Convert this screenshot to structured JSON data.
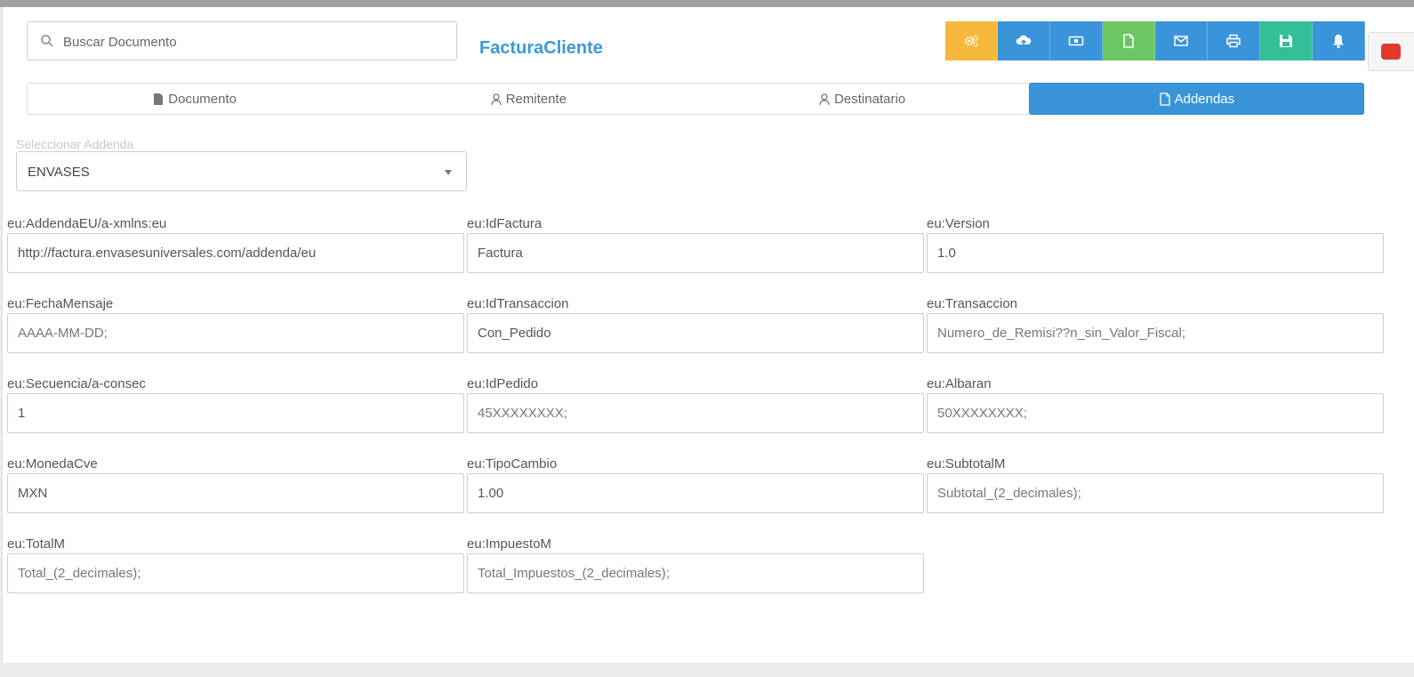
{
  "search": {
    "placeholder": "Buscar Documento"
  },
  "document": {
    "title": "FacturaCliente"
  },
  "toolbar": {
    "buttons": [
      {
        "name": "settings",
        "color": "#f6b93b"
      },
      {
        "name": "cloud-upload",
        "color": "#3a94d9"
      },
      {
        "name": "money",
        "color": "#3a94d9"
      },
      {
        "name": "file",
        "color": "#6cc763"
      },
      {
        "name": "email",
        "color": "#3a94d9"
      },
      {
        "name": "print",
        "color": "#3a94d9"
      },
      {
        "name": "save",
        "color": "#34bf97"
      },
      {
        "name": "bell",
        "color": "#3a94d9"
      }
    ]
  },
  "tabs": [
    {
      "label": "Documento",
      "icon": "file-icon"
    },
    {
      "label": "Remitente",
      "icon": "user-icon"
    },
    {
      "label": "Destinatario",
      "icon": "user-icon"
    },
    {
      "label": "Addendas",
      "icon": "file-outline-icon",
      "active": true
    }
  ],
  "addenda": {
    "label": "Seleccionar Addenda",
    "selected": "ENVASES"
  },
  "fields": [
    {
      "label": "eu:AddendaEU/a-xmlns:eu",
      "value": "http://factura.envasesuniversales.com/addenda/eu",
      "placeholder": ""
    },
    {
      "label": "eu:IdFactura",
      "value": "Factura",
      "placeholder": ""
    },
    {
      "label": "eu:Version",
      "value": "1.0",
      "placeholder": ""
    },
    {
      "label": "eu:FechaMensaje",
      "value": "",
      "placeholder": "AAAA-MM-DD;"
    },
    {
      "label": "eu:IdTransaccion",
      "value": "Con_Pedido",
      "placeholder": ""
    },
    {
      "label": "eu:Transaccion",
      "value": "",
      "placeholder": "Numero_de_Remisi??n_sin_Valor_Fiscal;"
    },
    {
      "label": "eu:Secuencia/a-consec",
      "value": "1",
      "placeholder": ""
    },
    {
      "label": "eu:IdPedido",
      "value": "",
      "placeholder": "45XXXXXXXX;"
    },
    {
      "label": "eu:Albaran",
      "value": "",
      "placeholder": "50XXXXXXXX;"
    },
    {
      "label": "eu:MonedaCve",
      "value": "MXN",
      "placeholder": ""
    },
    {
      "label": "eu:TipoCambio",
      "value": "1.00",
      "placeholder": ""
    },
    {
      "label": "eu:SubtotalM",
      "value": "",
      "placeholder": "Subtotal_(2_decimales);"
    },
    {
      "label": "eu:TotalM",
      "value": "",
      "placeholder": "Total_(2_decimales);"
    },
    {
      "label": "eu:ImpuestoM",
      "value": "",
      "placeholder": "Total_Impuestos_(2_decimales);"
    }
  ]
}
